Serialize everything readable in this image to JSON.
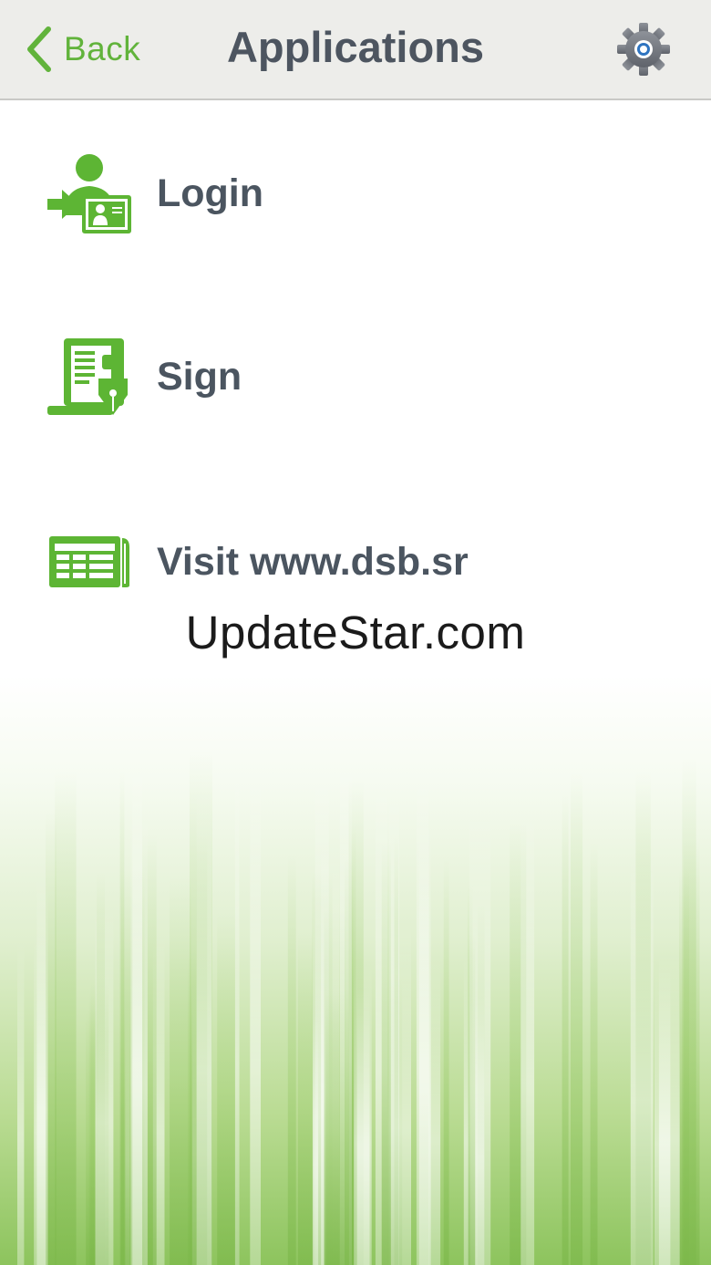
{
  "navbar": {
    "back_label": "Back",
    "title": "Applications",
    "back_icon": "chevron-left-icon",
    "settings_icon": "gear-icon"
  },
  "menu": {
    "items": [
      {
        "label": "Login",
        "icon": "login-user-icon"
      },
      {
        "label": "Sign",
        "icon": "sign-document-icon"
      },
      {
        "label": "Visit www.dsb.sr",
        "icon": "website-icon"
      }
    ]
  },
  "watermark": {
    "text": "UpdateStar.com"
  },
  "colors": {
    "accent": "#61b33b",
    "text": "#4b5560",
    "navbar_bg": "#ededea"
  }
}
